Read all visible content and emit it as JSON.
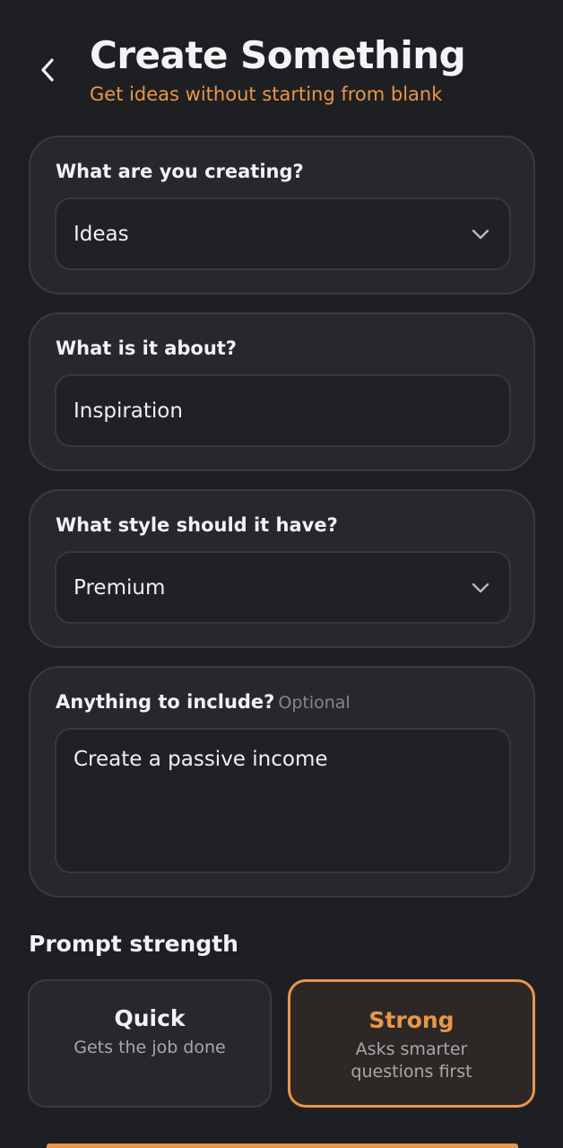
{
  "header": {
    "title": "Create Something",
    "subtitle": "Get ideas without starting from blank"
  },
  "form": {
    "creating": {
      "label": "What are you creating?",
      "value": "Ideas"
    },
    "about": {
      "label": "What is it about?",
      "value": "Inspiration"
    },
    "style": {
      "label": "What style should it have?",
      "value": "Premium"
    },
    "include": {
      "label": "Anything to include?",
      "optional": "Optional",
      "value": "Create a passive income"
    }
  },
  "strength": {
    "title": "Prompt strength",
    "selected": "Strong",
    "options": [
      {
        "title": "Quick",
        "desc": "Gets the job done"
      },
      {
        "title": "Strong",
        "desc": "Asks smarter questions first"
      }
    ]
  },
  "colors": {
    "accent": "#e8964a",
    "background": "#1e1f22",
    "card": "#27282c"
  },
  "icons": {
    "back": "chevron-left-icon",
    "dropdown": "chevron-down-icon"
  }
}
